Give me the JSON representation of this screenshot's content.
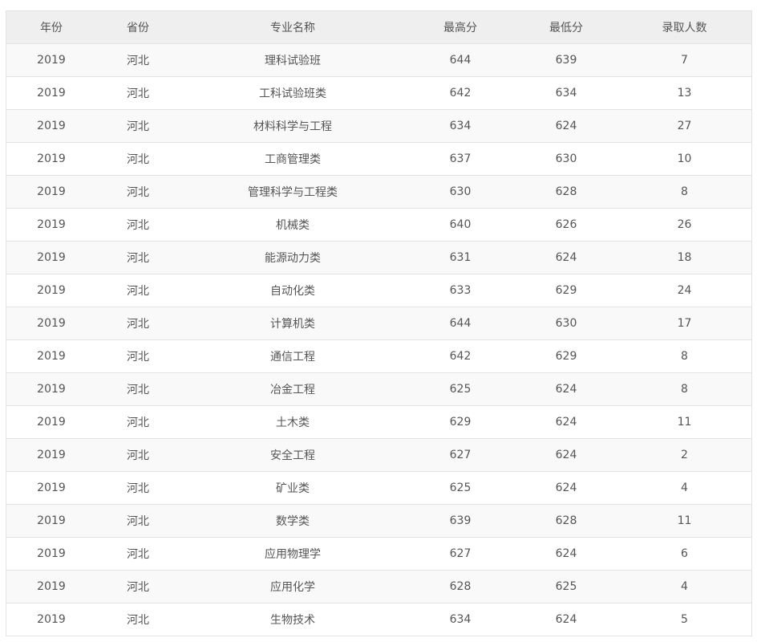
{
  "table": {
    "columns": [
      "年份",
      "省份",
      "专业名称",
      "最高分",
      "最低分",
      "录取人数"
    ],
    "rows": [
      [
        "2019",
        "河北",
        "理科试验班",
        "644",
        "639",
        "7"
      ],
      [
        "2019",
        "河北",
        "工科试验班类",
        "642",
        "634",
        "13"
      ],
      [
        "2019",
        "河北",
        "材料科学与工程",
        "634",
        "624",
        "27"
      ],
      [
        "2019",
        "河北",
        "工商管理类",
        "637",
        "630",
        "10"
      ],
      [
        "2019",
        "河北",
        "管理科学与工程类",
        "630",
        "628",
        "8"
      ],
      [
        "2019",
        "河北",
        "机械类",
        "640",
        "626",
        "26"
      ],
      [
        "2019",
        "河北",
        "能源动力类",
        "631",
        "624",
        "18"
      ],
      [
        "2019",
        "河北",
        "自动化类",
        "633",
        "629",
        "24"
      ],
      [
        "2019",
        "河北",
        "计算机类",
        "644",
        "630",
        "17"
      ],
      [
        "2019",
        "河北",
        "通信工程",
        "642",
        "629",
        "8"
      ],
      [
        "2019",
        "河北",
        "冶金工程",
        "625",
        "624",
        "8"
      ],
      [
        "2019",
        "河北",
        "土木类",
        "629",
        "624",
        "11"
      ],
      [
        "2019",
        "河北",
        "安全工程",
        "627",
        "624",
        "2"
      ],
      [
        "2019",
        "河北",
        "矿业类",
        "625",
        "624",
        "4"
      ],
      [
        "2019",
        "河北",
        "数学类",
        "639",
        "628",
        "11"
      ],
      [
        "2019",
        "河北",
        "应用物理学",
        "627",
        "624",
        "6"
      ],
      [
        "2019",
        "河北",
        "应用化学",
        "628",
        "625",
        "4"
      ],
      [
        "2019",
        "河北",
        "生物技术",
        "634",
        "624",
        "5"
      ]
    ]
  },
  "colors": {
    "header_bg": "#efefef",
    "row_odd_bg": "#f9f9f9",
    "row_even_bg": "#ffffff",
    "border": "#e3e3e3",
    "text": "#555555"
  }
}
